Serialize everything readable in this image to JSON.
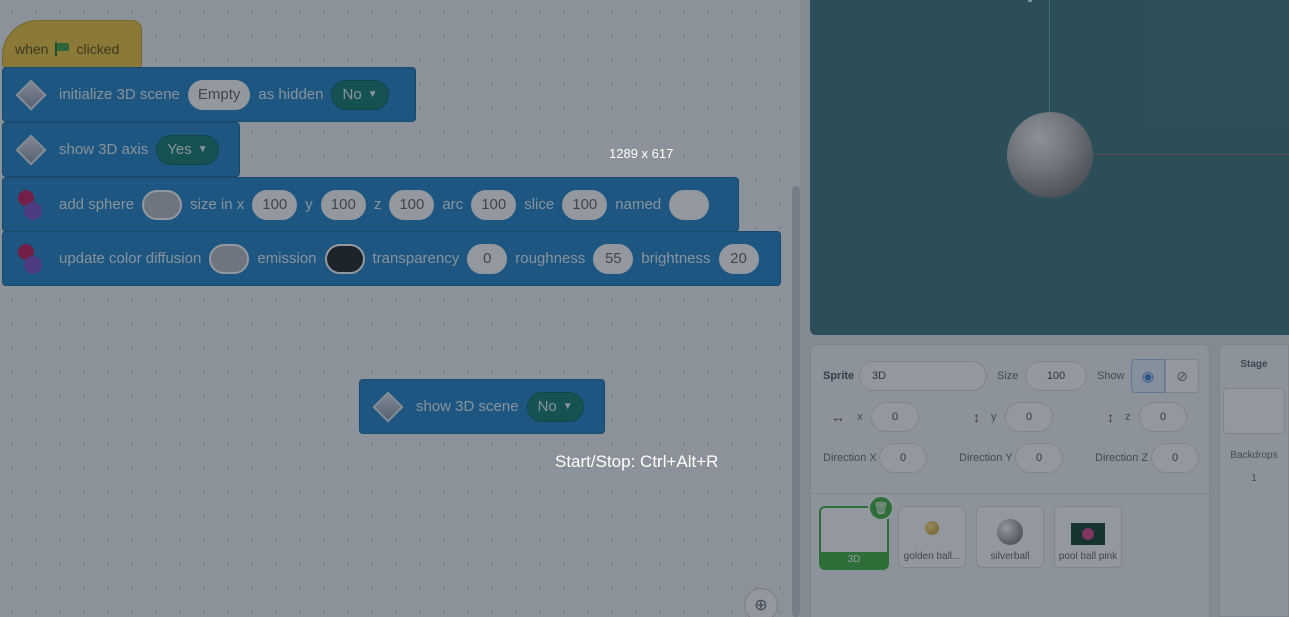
{
  "code": {
    "hat": {
      "when": "when",
      "clicked": "clicked"
    },
    "init_block": {
      "label": "initialize 3D scene",
      "scene_value": "Empty",
      "hidden_label": "as hidden",
      "hidden_value": "No"
    },
    "axis_block": {
      "label": "show 3D axis",
      "value": "Yes"
    },
    "sphere_block": {
      "label": "add sphere",
      "size_label": "size in x",
      "x": "100",
      "y_label": "y",
      "y": "100",
      "z_label": "z",
      "z": "100",
      "arc_label": "arc",
      "arc": "100",
      "slice_label": "slice",
      "slice": "100",
      "named_label": "named",
      "named": ""
    },
    "color_block": {
      "label": "update color diffusion",
      "emission_label": "emission",
      "transparency_label": "transparency",
      "transparency": "0",
      "roughness_label": "roughness",
      "roughness": "55",
      "brightness_label": "brightness",
      "brightness": "20"
    },
    "show_scene_block": {
      "label": "show 3D scene",
      "value": "No"
    },
    "colors": {
      "diffusion": "#b8bcc4",
      "emission": "#1e1f22"
    }
  },
  "sprite_info": {
    "sprite_label": "Sprite",
    "sprite_name": "3D",
    "size_label": "Size",
    "size": "100",
    "show_label": "Show",
    "x_label": "x",
    "x": "0",
    "y_label": "y",
    "y": "0",
    "z_label": "z",
    "z": "0",
    "dir_x_label": "Direction X",
    "dir_x": "0",
    "dir_y_label": "Direction Y",
    "dir_y": "0",
    "dir_z_label": "Direction Z",
    "dir_z": "0"
  },
  "sprites": [
    {
      "name": "3D",
      "selected": true
    },
    {
      "name": "golden ball...",
      "selected": false
    },
    {
      "name": "silverball",
      "selected": false
    },
    {
      "name": "pool ball pink",
      "selected": false
    }
  ],
  "stage_panel": {
    "title": "Stage",
    "backdrops_label": "Backdrops",
    "backdrops_count": "1"
  },
  "overlay": {
    "resolution": "1289 x 617",
    "shortcut": "Start/Stop: Ctrl+Alt+R"
  }
}
